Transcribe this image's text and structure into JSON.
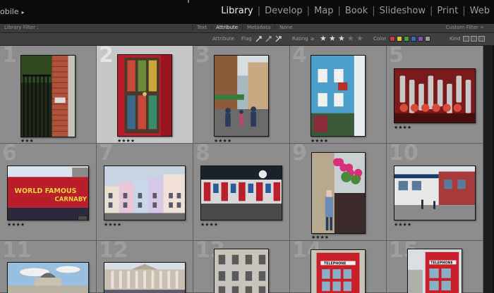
{
  "identity_plate": "obile",
  "modules": [
    {
      "label": "Library",
      "active": true
    },
    {
      "label": "Develop",
      "active": false
    },
    {
      "label": "Map",
      "active": false
    },
    {
      "label": "Book",
      "active": false
    },
    {
      "label": "Slideshow",
      "active": false
    },
    {
      "label": "Print",
      "active": false
    },
    {
      "label": "Web",
      "active": false
    }
  ],
  "filter_bar": {
    "title": "Library Filter :",
    "tabs": [
      {
        "label": "Text",
        "active": false
      },
      {
        "label": "Attribute",
        "active": true
      },
      {
        "label": "Metadata",
        "active": false
      },
      {
        "label": "None",
        "active": false
      }
    ],
    "preset": "Custom Filter ÷"
  },
  "attribute_bar": {
    "attribute_label": "Attribute",
    "flag_label": "Flag",
    "rating_label": "Rating",
    "rating_operator": "≥",
    "rating_stars_filled": 3,
    "rating_stars_total": 5,
    "color_label": "Color",
    "kind_label": "Kind",
    "color_swatches": [
      "#c83a3a",
      "#d8c43a",
      "#4a9a3a",
      "#3a62b4",
      "#8a4ab0",
      "#9a9a9a"
    ]
  },
  "grid": {
    "cells": [
      {
        "index": "1",
        "stars": "★★★",
        "selected": false,
        "scene": "gate"
      },
      {
        "index": "2",
        "stars": "★★★★",
        "selected": true,
        "scene": "door"
      },
      {
        "index": "3",
        "stars": "★★★★",
        "selected": false,
        "scene": "market-street"
      },
      {
        "index": "4",
        "stars": "★★★★",
        "selected": false,
        "scene": "blue-house"
      },
      {
        "index": "5",
        "stars": "★★★★",
        "selected": false,
        "scene": "trinkets"
      },
      {
        "index": "6",
        "stars": "★★★★",
        "selected": false,
        "scene": "shop-sign"
      },
      {
        "index": "7",
        "stars": "★★★★",
        "selected": false,
        "scene": "pastel-houses"
      },
      {
        "index": "8",
        "stars": "★★★★",
        "selected": false,
        "scene": "underground"
      },
      {
        "index": "9",
        "stars": "★★★★",
        "selected": false,
        "scene": "flower-shop"
      },
      {
        "index": "10",
        "stars": "★★★★",
        "selected": false,
        "scene": "corner-shop"
      },
      {
        "index": "11",
        "stars": "",
        "selected": false,
        "scene": "gallery-dome"
      },
      {
        "index": "12",
        "stars": "",
        "selected": false,
        "scene": "gallery-front"
      },
      {
        "index": "13",
        "stars": "",
        "selected": false,
        "scene": "facade"
      },
      {
        "index": "14",
        "stars": "",
        "selected": false,
        "scene": "phone-box"
      },
      {
        "index": "15",
        "stars": "",
        "selected": false,
        "scene": "phone-box-2"
      }
    ]
  }
}
